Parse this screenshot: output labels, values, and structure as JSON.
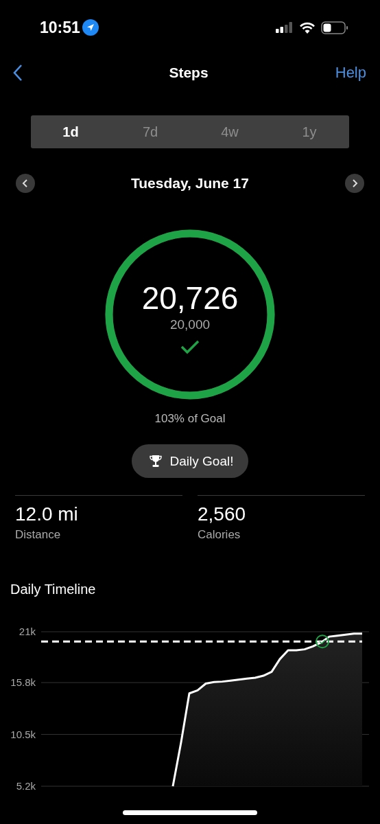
{
  "status_bar": {
    "time": "10:51"
  },
  "nav": {
    "title": "Steps",
    "action": "Help"
  },
  "ranges": [
    {
      "label": "1d",
      "selected": true
    },
    {
      "label": "7d",
      "selected": false
    },
    {
      "label": "4w",
      "selected": false
    },
    {
      "label": "1y",
      "selected": false
    }
  ],
  "date": "Tuesday, June 17",
  "progress": {
    "steps": "20,726",
    "goal": "20,000",
    "level": 1,
    "goal_met": true,
    "percent_text": "103% of Goal",
    "badge": "Daily Goal!"
  },
  "stats": [
    {
      "value": "12.0 mi",
      "label": "Distance"
    },
    {
      "value": "2,560",
      "label": "Calories"
    }
  ],
  "timeline": {
    "title": "Daily Timeline",
    "chart_data": {
      "type": "area",
      "grid": true,
      "ylim": [
        5200,
        21000
      ],
      "yticks": [
        {
          "value": 21000,
          "label": "21k"
        },
        {
          "value": 15800,
          "label": "15.8k"
        },
        {
          "value": 10500,
          "label": "10.5k"
        },
        {
          "value": 5200,
          "label": "5.2k"
        }
      ],
      "series": [
        {
          "color": "#ffffff",
          "values": [
            null,
            null,
            null,
            null,
            null,
            null,
            null,
            null,
            null,
            null,
            null,
            null,
            null,
            null,
            null,
            null,
            5200,
            9700,
            14700,
            15000,
            15700,
            15850,
            15900,
            16000,
            16100,
            16200,
            16300,
            16500,
            16900,
            18200,
            19100,
            19100,
            19200,
            19500,
            19900,
            20500,
            20600,
            20700,
            20800,
            20800
          ]
        },
        {
          "type": "line",
          "line_style": "dashed",
          "color": "#ffffff",
          "values": [
            20000,
            20000,
            20000,
            20000,
            20000,
            20000,
            20000,
            20000,
            20000,
            20000,
            20000,
            20000,
            20000,
            20000,
            20000,
            20000,
            20000,
            20000,
            20000,
            20000,
            20000,
            20000,
            20000,
            20000,
            20000,
            20000,
            20000,
            20000,
            20000,
            20000,
            20000,
            20000,
            20000,
            20000,
            20000,
            20000,
            20000,
            20000,
            20000,
            20000
          ]
        }
      ]
    }
  }
}
